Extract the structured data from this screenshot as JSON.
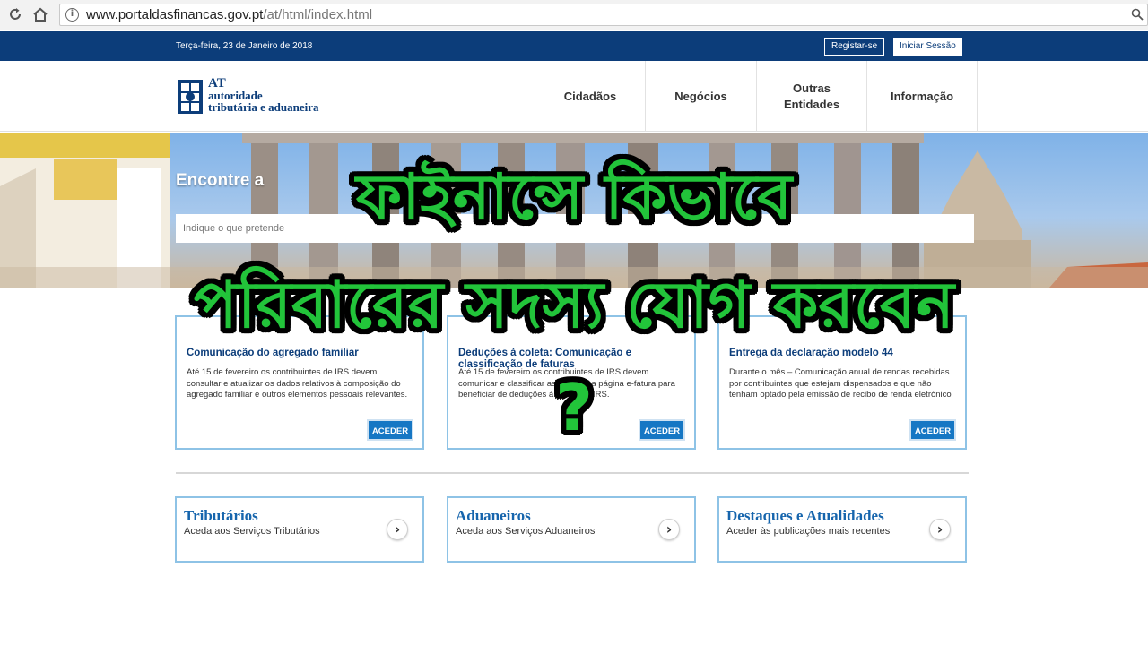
{
  "browser": {
    "back_icon": "back-arrow-icon",
    "home_icon": "home-icon",
    "url_host": "www.portaldasfinancas.gov.pt",
    "url_path": "/at/html/index.html"
  },
  "top_bar": {
    "date": "Terça-feira, 23 de Janeiro de 2018",
    "register_label": "Registar-se",
    "login_label": "Iniciar Sessão",
    "color": "#0c3d7a"
  },
  "logo": {
    "abbr": "AT",
    "line1": "autoridade",
    "line2": "tributária e aduaneira"
  },
  "nav": {
    "items": [
      {
        "label": "Cidadãos"
      },
      {
        "label": "Negócios"
      },
      {
        "label": "Outras Entidades"
      },
      {
        "label": "Informação"
      }
    ]
  },
  "hero": {
    "title": "Encontre a",
    "search_placeholder": "Indique o que pretende"
  },
  "news": [
    {
      "title": "Comunicação do agregado familiar",
      "body": "Até 15 de fevereiro os contribuintes de IRS devem consultar e atualizar os dados relativos à composição do agregado familiar e outros elementos pessoais relevantes.",
      "button": "ACEDER"
    },
    {
      "title": "Deduções à coleta: Comunicação e classificação de faturas",
      "body": "Até 15 de fevereiro os contribuintes de IRS devem comunicar e classificar as faturas na página e-fatura para beneficiar de deduções à coleta do IRS.",
      "button": "ACEDER"
    },
    {
      "title": "Entrega da declaração modelo 44",
      "body": "Durante o mês – Comunicação anual de rendas recebidas por contribuintes que estejam dispensados e que não tenham optado pela emissão de recibo de renda eletrónico",
      "button": "ACEDER"
    }
  ],
  "services": [
    {
      "title": "Tributários",
      "subtitle": "Aceda aos Serviços Tributários"
    },
    {
      "title": "Aduaneiros",
      "subtitle": "Aceda aos Serviços Aduaneiros"
    },
    {
      "title": "Destaques e Atualidades",
      "subtitle": "Aceder às publicações mais recentes"
    }
  ],
  "overlay": {
    "line1": "ফাইনান্সে কিভাবে",
    "line2": "পরিবারের সদস্য যোগ করবেন",
    "line3": "?",
    "text_color": "#22c43a",
    "outline_color": "#000000"
  },
  "colors": {
    "accent": "#1677c4",
    "card_border": "#8ec3e6",
    "service_title": "#1665ad"
  }
}
